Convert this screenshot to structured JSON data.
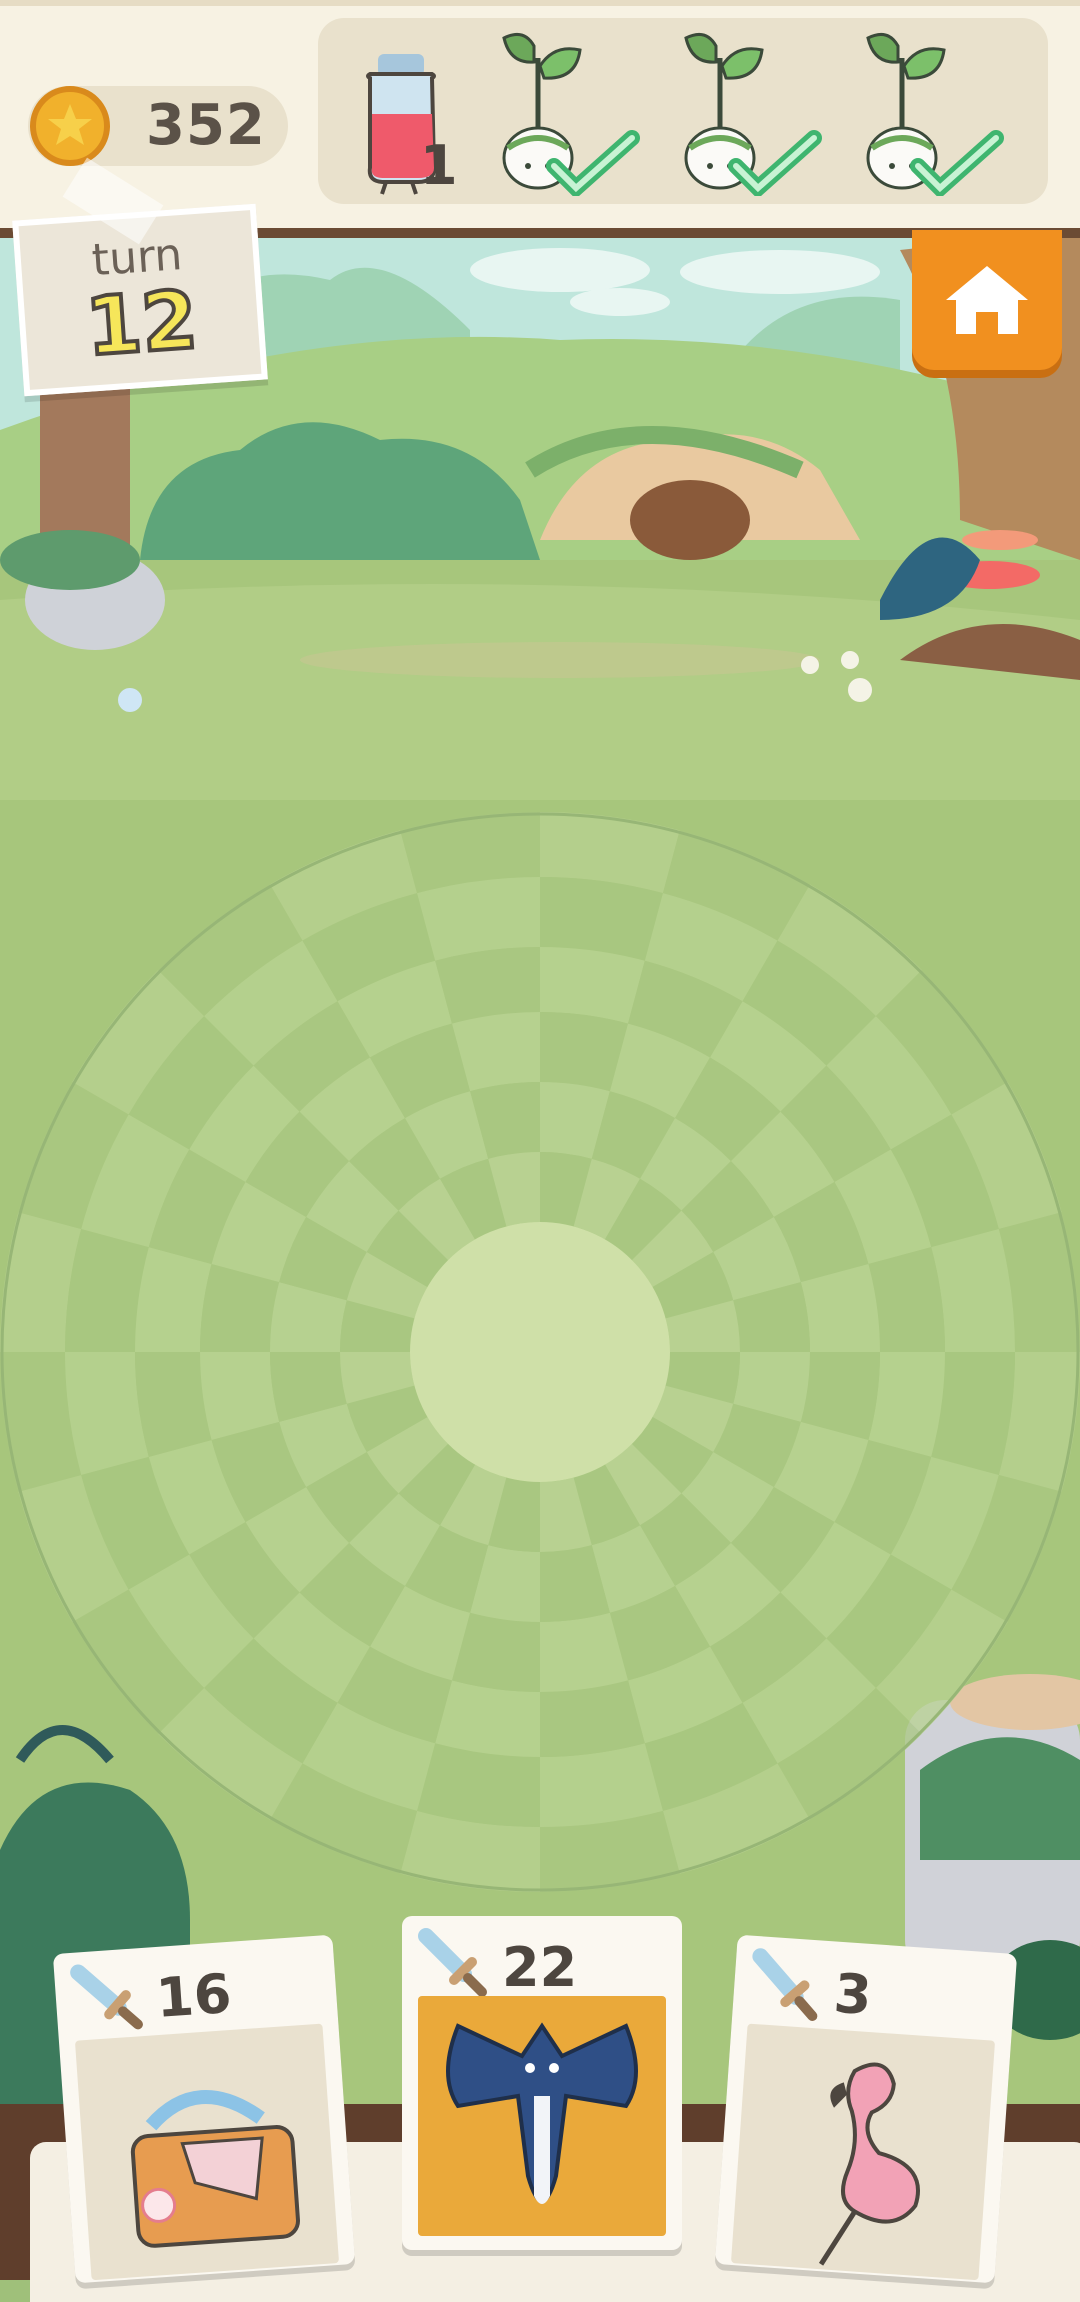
{
  "hud": {
    "coins": "352",
    "potion_count": "1",
    "objectives": [
      {
        "icon": "sprout-icon",
        "done": true
      },
      {
        "icon": "sprout-icon",
        "done": true
      },
      {
        "icon": "sprout-icon",
        "done": true
      }
    ]
  },
  "turn": {
    "label": "turn",
    "value": "12"
  },
  "cards": [
    {
      "attack": "16",
      "art": "picnic-basket-icon"
    },
    {
      "attack": "22",
      "art": "bat-icon",
      "selected": true
    },
    {
      "attack": "3",
      "art": "flamingo-icon"
    }
  ],
  "colors": {
    "topbar": "#f7f2e3",
    "home_button": "#f1901f",
    "turn_number": "#f6e65a",
    "check_green": "#3fb56f"
  }
}
